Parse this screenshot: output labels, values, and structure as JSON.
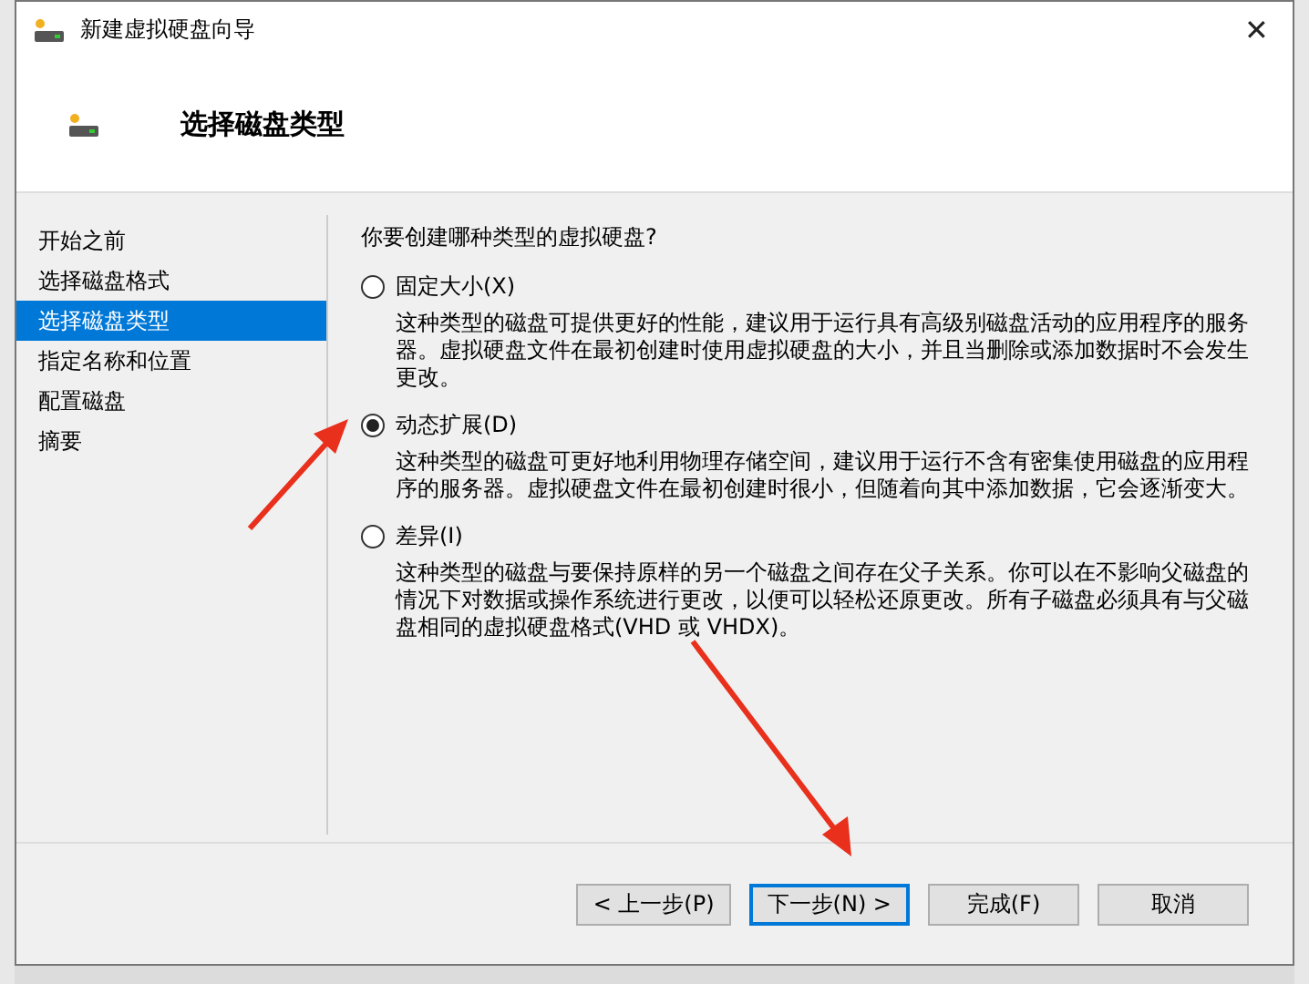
{
  "window": {
    "title": "新建虚拟硬盘向导"
  },
  "header": {
    "title": "选择磁盘类型"
  },
  "steps": [
    {
      "label": "开始之前",
      "selected": false
    },
    {
      "label": "选择磁盘格式",
      "selected": false
    },
    {
      "label": "选择磁盘类型",
      "selected": true
    },
    {
      "label": "指定名称和位置",
      "selected": false
    },
    {
      "label": "配置磁盘",
      "selected": false
    },
    {
      "label": "摘要",
      "selected": false
    }
  ],
  "question": "你要创建哪种类型的虚拟硬盘?",
  "options": [
    {
      "label": "固定大小(X)",
      "selected": false,
      "description": "这种类型的磁盘可提供更好的性能，建议用于运行具有高级别磁盘活动的应用程序的服务器。虚拟硬盘文件在最初创建时使用虚拟硬盘的大小，并且当删除或添加数据时不会发生更改。"
    },
    {
      "label": "动态扩展(D)",
      "selected": true,
      "description": "这种类型的磁盘可更好地利用物理存储空间，建议用于运行不含有密集使用磁盘的应用程序的服务器。虚拟硬盘文件在最初创建时很小，但随着向其中添加数据，它会逐渐变大。"
    },
    {
      "label": "差异(I)",
      "selected": false,
      "description": "这种类型的磁盘与要保持原样的另一个磁盘之间存在父子关系。你可以在不影响父磁盘的情况下对数据或操作系统进行更改，以便可以轻松还原更改。所有子磁盘必须具有与父磁盘相同的虚拟硬盘格式(VHD 或 VHDX)。"
    }
  ],
  "buttons": [
    {
      "label": "< 上一步(P)",
      "default": false
    },
    {
      "label": "下一步(N) >",
      "default": true
    },
    {
      "label": "完成(F)",
      "default": false
    },
    {
      "label": "取消",
      "default": false
    }
  ],
  "close_glyph": "✕"
}
